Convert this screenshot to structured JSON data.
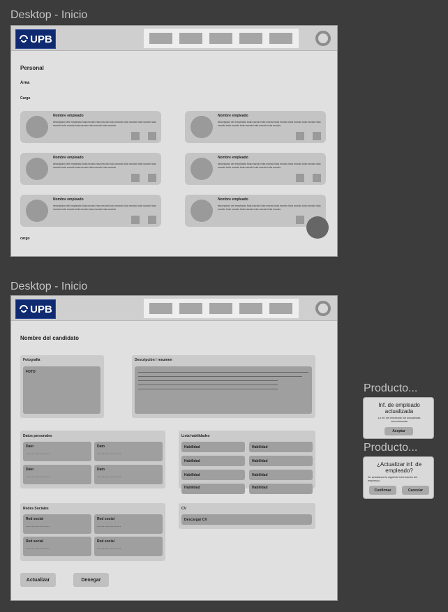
{
  "frames": [
    {
      "title": "Desktop - Inicio"
    },
    {
      "title": "Desktop - Inicio"
    }
  ],
  "logo_text": "UPB",
  "home": {
    "section_title": "Personal",
    "area_label": "Area",
    "cargo_label": "Cargo",
    "footer_label": "cargo",
    "employees": [
      {
        "name": "Nombre empleado",
        "description": "descripcion del empleado hola mundo hola mundo hola mundo hola mundo hola mundo hola mundo hola mundo hola mundo hola mundo hola mundo"
      },
      {
        "name": "Nombre empleado",
        "description": "descripcion del empleado hola mundo hola mundo hola mundo hola mundo hola mundo hola mundo hola mundo hola mundo hola mundo hola mundo"
      },
      {
        "name": "Nombre empleado",
        "description": "descripcion del empleado hola mundo hola mundo hola mundo hola mundo hola mundo hola mundo hola mundo hola mundo hola mundo hola mundo"
      },
      {
        "name": "Nombre empleado",
        "description": "descripcion del empleado hola mundo hola mundo hola mundo hola mundo hola mundo hola mundo hola mundo hola mundo hola mundo hola mundo"
      },
      {
        "name": "Nombre empleado",
        "description": "descripcion del empleado hola mundo hola mundo hola mundo hola mundo hola mundo hola mundo hola mundo hola mundo hola mundo hola mundo"
      },
      {
        "name": "Nombre empleado",
        "description": "descripcion del empleado hola mundo hola mundo hola mundo hola mundo hola mundo hola mundo hola mundo hola mundo hola mundo hola mundo"
      }
    ]
  },
  "candidate": {
    "title": "Nombre del candidato",
    "photo_panel": {
      "title": "Fotografía",
      "placeholder": "FOTO"
    },
    "description_panel": {
      "title": "Descripción / resumen"
    },
    "personal_data": {
      "title": "Datos personales",
      "fields": [
        {
          "label": "Dato",
          "value": "----------------"
        },
        {
          "label": "Dato",
          "value": "----------------"
        },
        {
          "label": "Dato",
          "value": "----------------"
        },
        {
          "label": "Dato",
          "value": "----------------"
        }
      ]
    },
    "skills": {
      "title": "Lista habilidades",
      "items": [
        "Habilidad",
        "Habilidad",
        "Habilidad",
        "Habilidad",
        "Habilidad",
        "Habilidad",
        "Habilidad",
        "Habilidad"
      ]
    },
    "social": {
      "title": "Redes Sociales",
      "fields": [
        {
          "label": "Red social",
          "value": "----------------"
        },
        {
          "label": "Red social",
          "value": "----------------"
        },
        {
          "label": "Red social",
          "value": "----------------"
        },
        {
          "label": "Red social",
          "value": "----------------"
        }
      ]
    },
    "cv": {
      "title": "CV",
      "download_label": "Descargar CV"
    },
    "update_button": "Actualizar",
    "deny_button": "Denegar"
  },
  "dialogs": [
    {
      "frame_title": "Producto...",
      "title": "Inf. de empleado actualizada",
      "message": "La inf. del empleado fue actualizada correctamente",
      "accept_label": "Aceptar"
    },
    {
      "frame_title": "Producto...",
      "title": "¿Actualizar inf. de empleado?",
      "message": "Se actualizará la siguiente información del empleado:",
      "confirm_label": "Confirmar",
      "cancel_label": "Cancelar"
    }
  ]
}
